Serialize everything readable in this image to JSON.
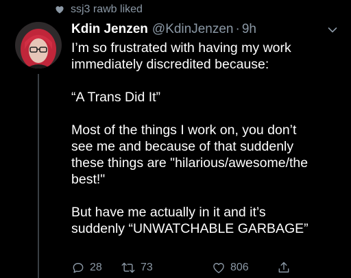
{
  "social_context": {
    "text": "ssj3 rawb liked"
  },
  "tweet": {
    "display_name": "Kdin Jenzen",
    "handle": "@KdinJenzen",
    "separator": "·",
    "time": "9h",
    "paragraphs": [
      "I’m so frustrated with having my work\nimmediately discredited because:",
      "“A Trans Did It”",
      "Most of the things I work on, you don’t\nsee me and because of that suddenly\nthese things are \"hilarious/awesome/the\nbest!\"",
      "But have me actually in it and it’s\nsuddenly “UNWATCHABLE GARBAGE”"
    ]
  },
  "actions": {
    "reply_count": "28",
    "retweet_count": "73",
    "like_count": "806"
  },
  "icons": {
    "heart": "heart-icon",
    "reply": "reply-icon",
    "retweet": "retweet-icon",
    "like": "like-icon",
    "share": "share-icon",
    "caret": "chevron-down-icon"
  },
  "colors": {
    "background": "#000000",
    "text_primary": "#ffffff",
    "text_secondary": "#8b98a5"
  }
}
